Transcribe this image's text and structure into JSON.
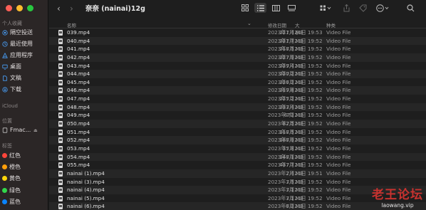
{
  "window": {
    "title": "奈奈 (nainai)12g"
  },
  "sidebar": {
    "favorites_label": "个人收藏",
    "favorites": [
      {
        "label": "隔空投送",
        "icon": "airdrop-icon"
      },
      {
        "label": "最近使用",
        "icon": "clock-icon"
      },
      {
        "label": "应用程序",
        "icon": "applications-icon"
      },
      {
        "label": "桌面",
        "icon": "desktop-icon"
      },
      {
        "label": "文稿",
        "icon": "document-icon"
      },
      {
        "label": "下载",
        "icon": "download-icon"
      }
    ],
    "icloud_label": "iCloud",
    "locations_label": "位置",
    "locations": [
      {
        "label": "Fmac...",
        "icon": "computer-icon"
      }
    ],
    "tags_label": "标签",
    "tags": [
      {
        "label": "红色",
        "color": "#ff453a"
      },
      {
        "label": "橙色",
        "color": "#ff9f0a"
      },
      {
        "label": "黄色",
        "color": "#ffd60a"
      },
      {
        "label": "绿色",
        "color": "#32d74b"
      },
      {
        "label": "蓝色",
        "color": "#0a84ff"
      }
    ]
  },
  "columns": {
    "name": "名称",
    "date": "修改日期",
    "size": "大小",
    "kind": "种类"
  },
  "files": [
    {
      "name": "039.mp4",
      "date": "2023年7月21日 19:53",
      "size": "221.4 MB",
      "kind": "Video File"
    },
    {
      "name": "040.mp4",
      "date": "2023年7月21日 19:52",
      "size": "221.7 MB",
      "kind": "Video File"
    },
    {
      "name": "041.mp4",
      "date": "2023年7月21日 19:52",
      "size": "218.5 MB",
      "kind": "Video File"
    },
    {
      "name": "042.mp4",
      "date": "2023年7月21日 19:52",
      "size": "227.9 MB",
      "kind": "Video File"
    },
    {
      "name": "043.mp4",
      "date": "2023年7月21日 19:52",
      "size": "229.4 MB",
      "kind": "Video File"
    },
    {
      "name": "044.mp4",
      "date": "2023年7月21日 19:52",
      "size": "220.2 MB",
      "kind": "Video File"
    },
    {
      "name": "045.mp4",
      "date": "2023年7月21日 19:52",
      "size": "226.2 MB",
      "kind": "Video File"
    },
    {
      "name": "046.mp4",
      "date": "2023年7月21日 19:52",
      "size": "219.8 MB",
      "kind": "Video File"
    },
    {
      "name": "047.mp4",
      "date": "2023年7月21日 19:52",
      "size": "225.2 MB",
      "kind": "Video File"
    },
    {
      "name": "048.mp4",
      "date": "2023年7月21日 19:52",
      "size": "233.4 MB",
      "kind": "Video File"
    },
    {
      "name": "049.mp4",
      "date": "2023年7月21日 19:52",
      "size": "672 MB",
      "kind": "Video File"
    },
    {
      "name": "050.mp4",
      "date": "2023年7月21日 19:52",
      "size": "82.5 MB",
      "kind": "Video File"
    },
    {
      "name": "051.mp4",
      "date": "2023年7月21日 19:52",
      "size": "118.5 MB",
      "kind": "Video File"
    },
    {
      "name": "052.mp4",
      "date": "2023年7月21日 19:52",
      "size": "188.9 MB",
      "kind": "Video File"
    },
    {
      "name": "053.mp4",
      "date": "2023年7月21日 19:52",
      "size": "35.8 MB",
      "kind": "Video File"
    },
    {
      "name": "054.mp4",
      "date": "2023年7月21日 19:52",
      "size": "148.1 MB",
      "kind": "Video File"
    },
    {
      "name": "055.mp4",
      "date": "2023年7月21日 19:52",
      "size": "437.7 MB",
      "kind": "Video File"
    },
    {
      "name": "nainai (1).mp4",
      "date": "2023年7月21日 19:51",
      "size": "2.4 MB",
      "kind": "Video File"
    },
    {
      "name": "nainai (3).mp4",
      "date": "2023年7月21日 19:52",
      "size": "3.5 MB",
      "kind": "Video File"
    },
    {
      "name": "nainai (4).mp4",
      "date": "2023年7月21日 19:52",
      "size": "3.1 MB",
      "kind": "Video File"
    },
    {
      "name": "nainai (5).mp4",
      "date": "2023年7月21日 19:52",
      "size": "3.1 MB",
      "kind": "Video File"
    },
    {
      "name": "nainai (6).mp4",
      "date": "2023年7月21日 19:52",
      "size": "6.2 MB",
      "kind": "Video File"
    }
  ],
  "watermark": {
    "title": "老王论坛",
    "subtitle": "laowang.vip"
  }
}
